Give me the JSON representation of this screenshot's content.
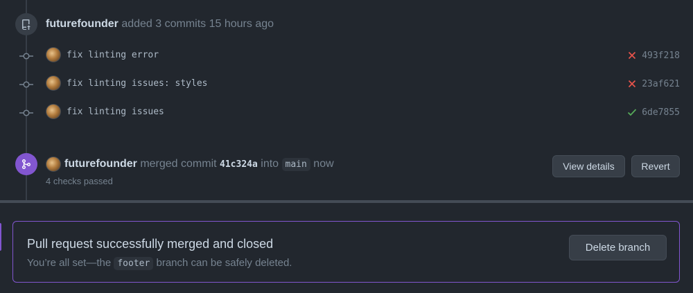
{
  "push_event": {
    "author": "futurefounder",
    "action": "added 3 commits 15 hours ago"
  },
  "commits": [
    {
      "message": "fix linting error",
      "status": "failed",
      "sha": "493f218"
    },
    {
      "message": "fix linting issues: styles",
      "status": "failed",
      "sha": "23af621"
    },
    {
      "message": "fix linting issues",
      "status": "success",
      "sha": "6de7855"
    }
  ],
  "merge_event": {
    "author": "futurefounder",
    "verb": "merged commit",
    "commit_sha": "41c324a",
    "into_word": "into",
    "branch": "main",
    "time": "now",
    "checks": "4 checks passed",
    "view_details_label": "View details",
    "revert_label": "Revert"
  },
  "merged_box": {
    "title": "Pull request successfully merged and closed",
    "sub_prefix": "You’re all set—the",
    "branch": "footer",
    "sub_suffix": "branch can be safely deleted.",
    "delete_label": "Delete branch"
  },
  "colors": {
    "failed": "#e5534b",
    "success": "#57ab5a",
    "merge_purple": "#8256d0"
  }
}
